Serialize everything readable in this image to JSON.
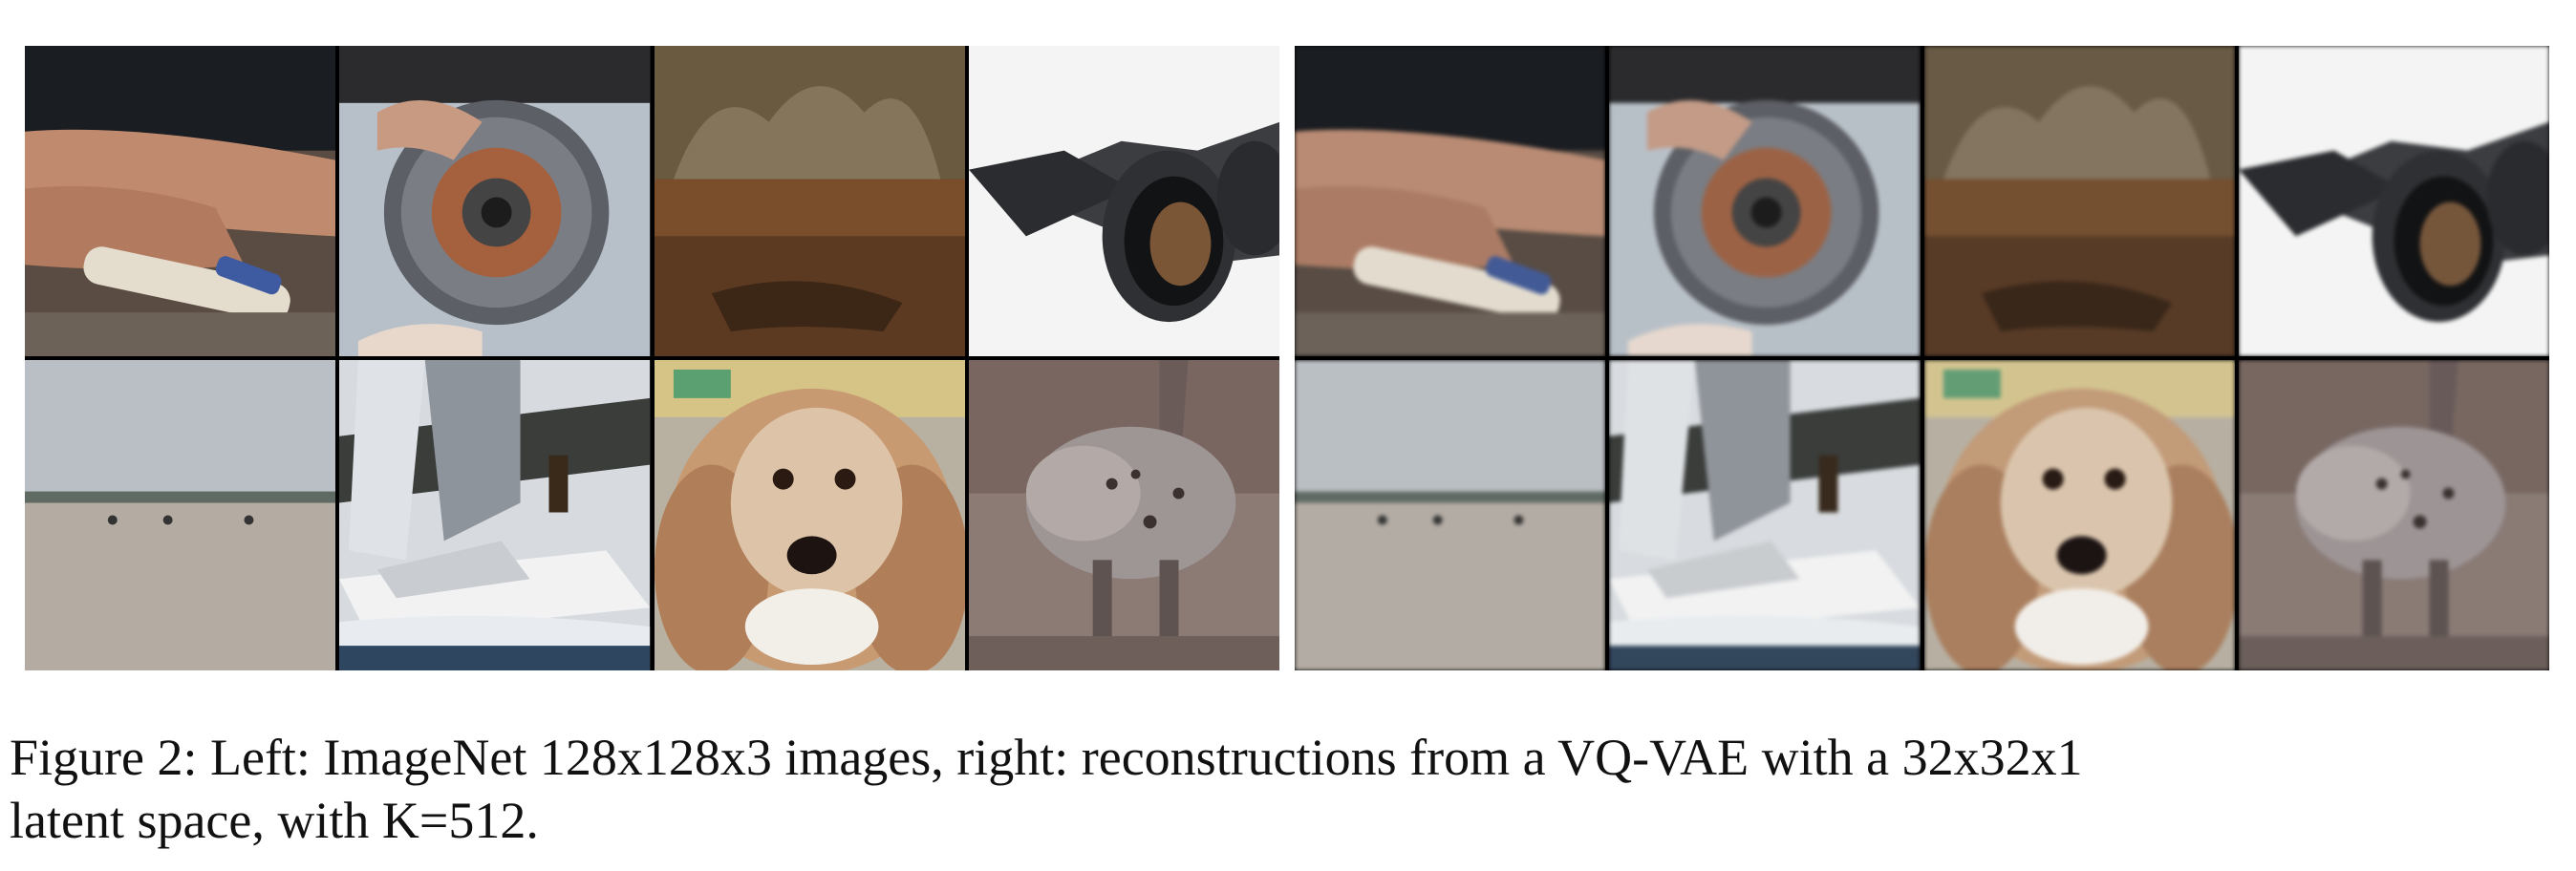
{
  "figure": {
    "caption_line1": "Figure 2: Left: ImageNet 128x128x3 images, right: reconstructions from a VQ-VAE with a 32x32x1",
    "caption_line2": "latent space, with K=512."
  },
  "panels": {
    "left": {
      "tiles": [
        "hands-with-yarn",
        "brake-disc",
        "field-scene",
        "binoculars",
        "beach-figures",
        "sailboat",
        "spaniel-dog",
        "hyena"
      ]
    },
    "right": {
      "tiles": [
        "hands-with-yarn",
        "brake-disc",
        "field-scene",
        "binoculars",
        "beach-figures",
        "sailboat",
        "spaniel-dog",
        "hyena"
      ]
    }
  }
}
